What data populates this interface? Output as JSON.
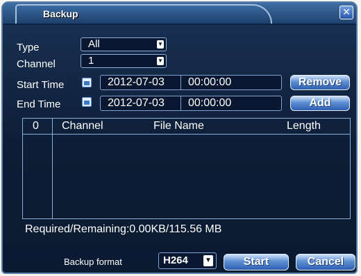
{
  "window": {
    "title": "Backup",
    "close_icon": "✕"
  },
  "form": {
    "type_label": "Type",
    "type_value": "All",
    "channel_label": "Channel",
    "channel_value": "1",
    "start_label": "Start Time",
    "start_date": "2012-07-03",
    "start_time": "00:00:00",
    "end_label": "End Time",
    "end_date": "2012-07-03",
    "end_time": "00:00:00",
    "remove_label": "Remove",
    "add_label": "Add"
  },
  "table": {
    "columns": [
      "0",
      "Channel",
      "File Name",
      "Length"
    ],
    "rows": []
  },
  "status": {
    "text": "Required/Remaining:0.00KB/115.56 MB"
  },
  "footer": {
    "format_label": "Backup format",
    "format_value": "H264",
    "start_label": "Start",
    "cancel_label": "Cancel"
  }
}
